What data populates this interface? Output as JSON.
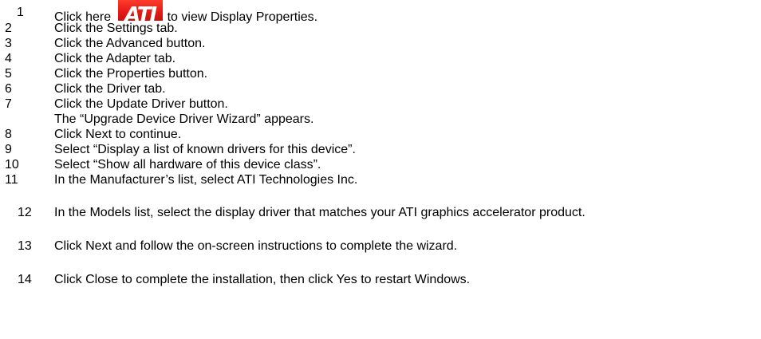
{
  "steps": [
    {
      "num": "1",
      "before": "Click here",
      "logo": "ATI",
      "after": "to view Display Properties."
    },
    {
      "num": "2",
      "text": "Click the Settings tab."
    },
    {
      "num": "3",
      "text": "Click the Advanced button."
    },
    {
      "num": "4",
      "text": "Click the Adapter tab."
    },
    {
      "num": "5",
      "text": "Click the Properties button."
    },
    {
      "num": "6",
      "text": "Click the Driver tab."
    },
    {
      "num": "7",
      "text": "Click the Update Driver button."
    },
    {
      "note": "The “Upgrade Device Driver Wizard” appears."
    },
    {
      "num": "8",
      "text": "Click Next to continue."
    },
    {
      "num": "9",
      "text": "Select “Display a list of known drivers for this device”."
    },
    {
      "num": "10",
      "text": "Select “Show all hardware of this device class”."
    },
    {
      "num": "11",
      "text": "In the Manufacturer’s list, select ATI Technologies Inc."
    },
    {
      "num": "12",
      "text": "In the Models list, select the display driver that matches your ATI graphics accelerator product."
    },
    {
      "num": "13",
      "text": "Click Next and follow the on-screen instructions to complete the wizard."
    },
    {
      "num": "14",
      "text": "Click Close to complete the installation, then click Yes to restart Windows."
    }
  ],
  "colors": {
    "logo_background": "#e41b17",
    "logo_text": "#ffffff"
  }
}
